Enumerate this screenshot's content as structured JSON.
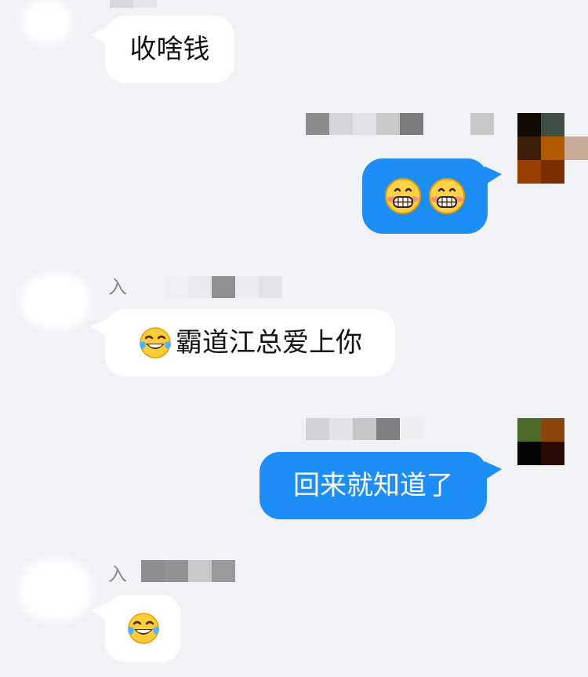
{
  "messages": [
    {
      "side": "left",
      "text": "收啥钱"
    },
    {
      "side": "right",
      "emoji": [
        "grin-blush",
        "grin-blush"
      ]
    },
    {
      "side": "left",
      "sender_fragment": "入",
      "emoji_prefix": "tears-of-joy",
      "text": "霸道江总爱上你"
    },
    {
      "side": "right",
      "text": "回来就知道了"
    },
    {
      "side": "left",
      "sender_fragment": "入",
      "emoji": [
        "tears-of-joy"
      ]
    }
  ],
  "colors": {
    "background": "#f1f2f6",
    "bubble_left": "#ffffff",
    "bubble_right": "#1e8ef7",
    "text_left": "#111111",
    "text_right": "#ffffff"
  },
  "icons": {
    "grin_blush": "grinning-face-with-blush-icon",
    "tears_of_joy": "face-with-tears-of-joy-icon"
  }
}
